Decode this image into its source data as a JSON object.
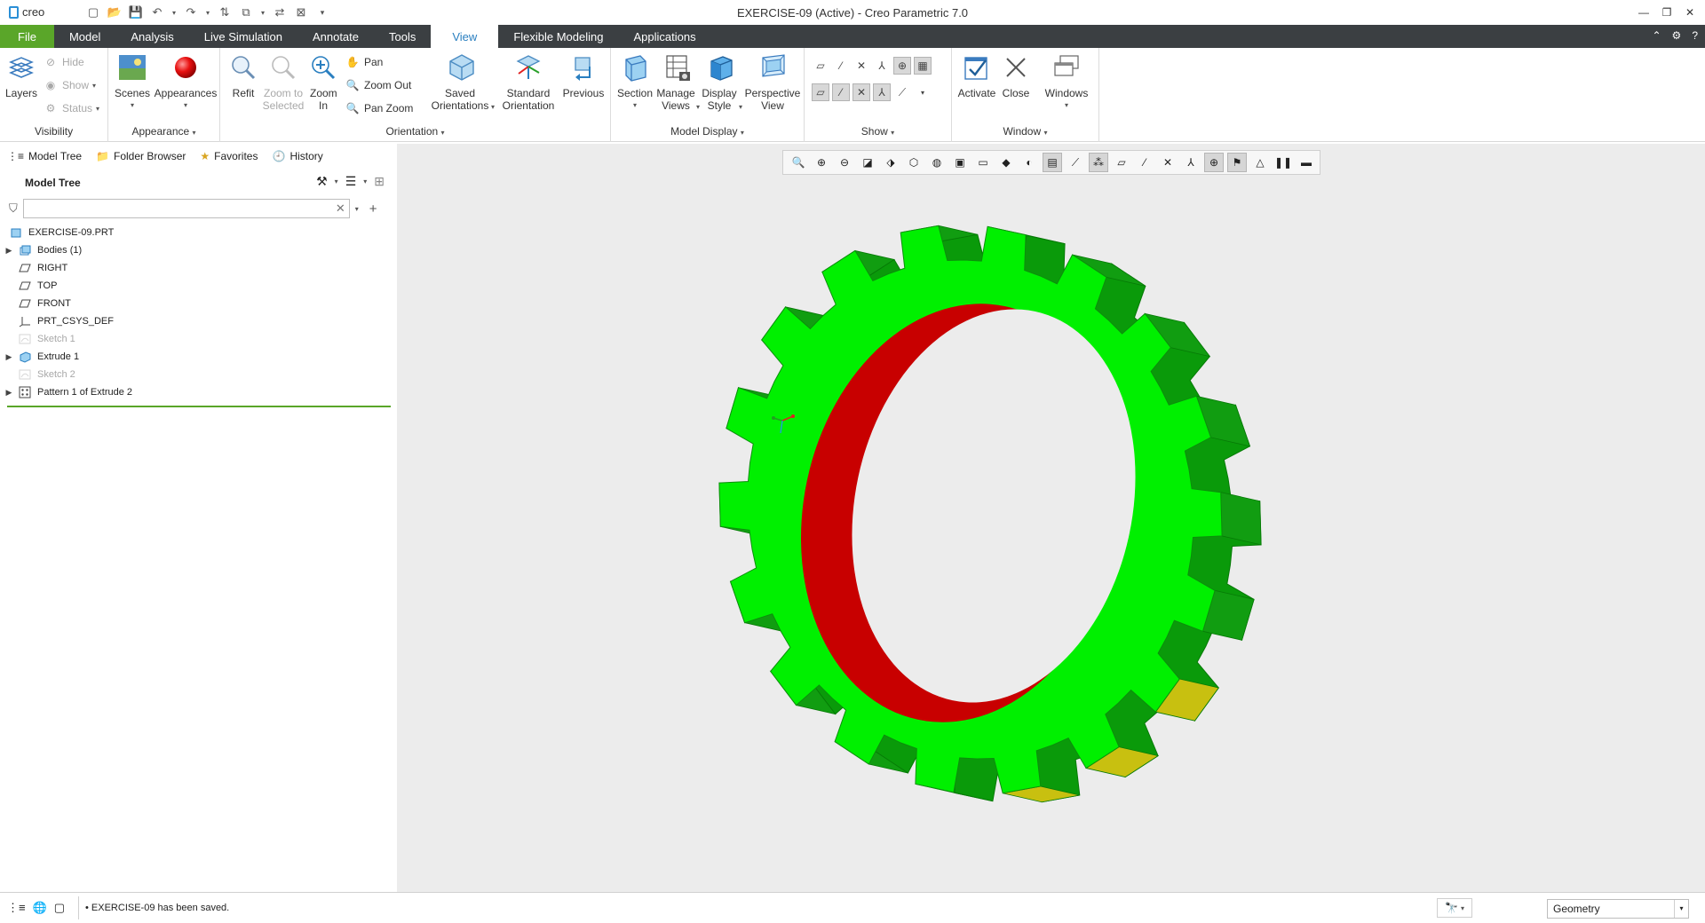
{
  "app": {
    "logo": "creo",
    "title": "EXERCISE-09 (Active) - Creo Parametric 7.0"
  },
  "tabs": [
    "File",
    "Model",
    "Analysis",
    "Live Simulation",
    "Annotate",
    "Tools",
    "View",
    "Flexible Modeling",
    "Applications"
  ],
  "ribbon": {
    "visibility": {
      "title": "Visibility",
      "layers": "Layers",
      "hide": "Hide",
      "show": "Show",
      "status": "Status"
    },
    "appearance": {
      "title": "Appearance",
      "scenes": "Scenes",
      "appearances": "Appearances"
    },
    "orientation": {
      "title": "Orientation",
      "refit": "Refit",
      "zoom_to_selected": "Zoom to Selected",
      "zoom_in": "Zoom In",
      "pan": "Pan",
      "zoom_out": "Zoom Out",
      "pan_zoom": "Pan Zoom",
      "saved_orientations": "Saved Orientations",
      "standard_orientation": "Standard Orientation",
      "previous": "Previous"
    },
    "model_display": {
      "title": "Model Display",
      "section": "Section",
      "manage_views": "Manage Views",
      "display_style": "Display Style",
      "perspective_view": "Perspective View"
    },
    "show": {
      "title": "Show"
    },
    "window": {
      "title": "Window",
      "activate": "Activate",
      "close": "Close",
      "windows": "Windows"
    }
  },
  "nav_tabs": [
    "Model Tree",
    "Folder Browser",
    "Favorites",
    "History"
  ],
  "model_tree": {
    "title": "Model Tree",
    "items": [
      {
        "label": "EXERCISE-09.PRT",
        "icon": "part-icon",
        "expandable": false,
        "dim": false,
        "root": true
      },
      {
        "label": "Bodies (1)",
        "icon": "bodies-icon",
        "expandable": true,
        "dim": false
      },
      {
        "label": "RIGHT",
        "icon": "datum-plane-icon",
        "expandable": false,
        "dim": false
      },
      {
        "label": "TOP",
        "icon": "datum-plane-icon",
        "expandable": false,
        "dim": false
      },
      {
        "label": "FRONT",
        "icon": "datum-plane-icon",
        "expandable": false,
        "dim": false
      },
      {
        "label": "PRT_CSYS_DEF",
        "icon": "csys-icon",
        "expandable": false,
        "dim": false
      },
      {
        "label": "Sketch 1",
        "icon": "sketch-icon",
        "expandable": false,
        "dim": true
      },
      {
        "label": "Extrude 1",
        "icon": "extrude-icon",
        "expandable": true,
        "dim": false
      },
      {
        "label": "Sketch 2",
        "icon": "sketch-icon",
        "expandable": false,
        "dim": true
      },
      {
        "label": "Pattern 1 of Extrude 2",
        "icon": "pattern-icon",
        "expandable": true,
        "dim": false
      }
    ]
  },
  "status": {
    "message": "EXERCISE-09 has been saved.",
    "filter_value": "Geometry"
  },
  "colors": {
    "file_tab": "#5aa629",
    "tab_bar": "#3b3f42",
    "active_tab_text": "#2a7fc0",
    "gear_face": "#00f000",
    "gear_side": "#0a9a0a",
    "bore": "#c80000",
    "graphics_bg": "#ececec"
  }
}
